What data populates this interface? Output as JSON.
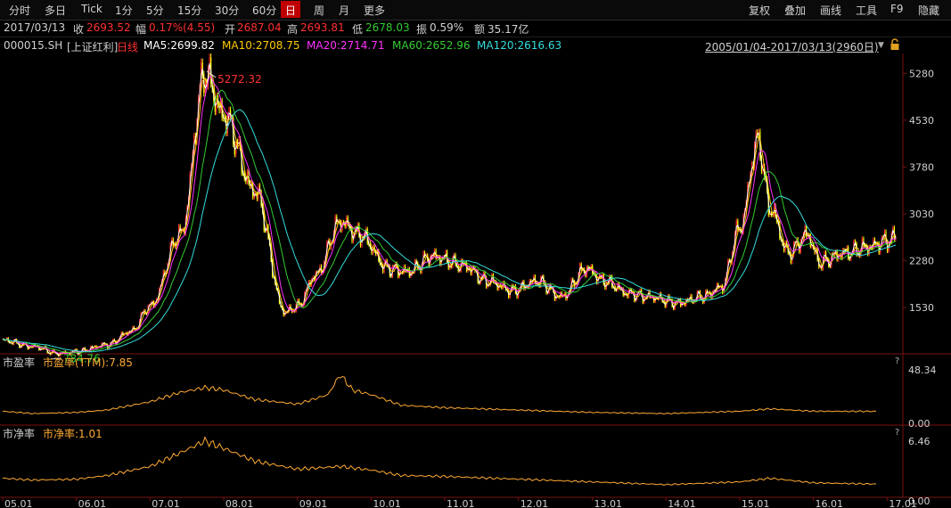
{
  "toolbar": {
    "left": [
      "分时",
      "多日",
      "Tick",
      "1分",
      "5分",
      "15分",
      "30分",
      "60分",
      "日",
      "周",
      "月",
      "更多"
    ],
    "right": [
      "复权",
      "叠加",
      "画线",
      "工具",
      "F9",
      "隐藏"
    ],
    "active": "日"
  },
  "quote": {
    "date": "2017/03/13",
    "close_label": "收",
    "close": "2693.52",
    "change_label": "幅",
    "change": "0.17%(4.55)",
    "open_label": "开",
    "open": "2687.04",
    "high_label": "高",
    "high": "2693.81",
    "low_label": "低",
    "low": "2678.03",
    "amp_label": "振",
    "amplitude": "0.59%",
    "amount_label": "额",
    "amount": "35.17亿"
  },
  "indicator": {
    "code": "000015.SH",
    "name": "[上证红利]",
    "period": "日线",
    "ma": [
      {
        "text": "MA5:2699.82",
        "color": "#ffffff"
      },
      {
        "text": "MA10:2708.75",
        "color": "#ffcc00"
      },
      {
        "text": "MA20:2714.71",
        "color": "#ff33ff"
      },
      {
        "text": "MA60:2652.96",
        "color": "#33cc33"
      },
      {
        "text": "MA120:2616.63",
        "color": "#33dddd"
      }
    ],
    "range": "2005/01/04-2017/03/13(2960日)"
  },
  "colors": {
    "up": "#ff3030",
    "down": "#ffff00",
    "ma5": "#ffffff",
    "ma10": "#ffcc00",
    "ma20": "#ff33ff",
    "ma60": "#33cc33",
    "ma120": "#33dddd",
    "sub": "#ffaa33"
  },
  "pe_panel": {
    "name": "市盈率",
    "indicator": "市盈率(TTM):7.85",
    "help": "?",
    "axis_top": "48.34",
    "axis_bottom": "0.00"
  },
  "pb_panel": {
    "name": "市净率",
    "indicator": "市净率:1.01",
    "help": "?",
    "axis_top": "6.46",
    "axis_bottom": "0.00"
  },
  "chart_data": [
    {
      "type": "line",
      "title": "000015.SH [上证红利] 日线",
      "x": [
        "2005-01",
        "2005-06",
        "2005-10",
        "2006-01",
        "2006-06",
        "2006-10",
        "2007-01",
        "2007-06",
        "2007-10",
        "2008-01",
        "2008-06",
        "2008-11",
        "2009-01",
        "2009-04",
        "2009-08",
        "2009-11",
        "2010-04",
        "2010-07",
        "2010-11",
        "2011-04",
        "2011-08",
        "2011-12",
        "2012-04",
        "2012-08",
        "2012-12",
        "2013-03",
        "2013-07",
        "2013-10",
        "2014-03",
        "2014-07",
        "2014-10",
        "2015-01",
        "2015-04",
        "2015-06",
        "2015-09",
        "2015-12",
        "2016-02",
        "2016-06",
        "2016-10",
        "2017-01",
        "2017-03"
      ],
      "series": [
        {
          "name": "",
          "values": [
            1000,
            900,
            790,
            820,
            930,
            1150,
            1550,
            2700,
            5272,
            4600,
            3400,
            1450,
            1550,
            2050,
            2900,
            2700,
            2150,
            2100,
            2350,
            2200,
            1950,
            1800,
            1950,
            1700,
            2150,
            1950,
            1750,
            1700,
            1600,
            1700,
            1850,
            2800,
            4200,
            3100,
            2400,
            2700,
            2250,
            2400,
            2500,
            2600,
            2693
          ]
        }
      ],
      "yticks": [
        "5280",
        "4530",
        "3780",
        "3030",
        "2280",
        "1530"
      ],
      "ylim": [
        800,
        5600
      ],
      "annotations": [
        {
          "text": "5272.32",
          "color": "#ff3030"
        },
        {
          "text": "784.76",
          "color": "#33cc33"
        }
      ],
      "xtick_labels": [
        "05.01",
        "06.01",
        "07.01",
        "08.01",
        "09.01",
        "10.01",
        "11.01",
        "12.01",
        "13.01",
        "14.01",
        "15.01",
        "16.01",
        "17.01"
      ]
    },
    {
      "type": "line",
      "title": "市盈率",
      "x": [
        "2005-01",
        "2005-06",
        "2006-01",
        "2006-06",
        "2007-01",
        "2007-06",
        "2007-10",
        "2008-01",
        "2008-06",
        "2009-01",
        "2009-06",
        "2009-08",
        "2009-10",
        "2010-01",
        "2010-06",
        "2011-01",
        "2012-01",
        "2013-01",
        "2014-01",
        "2015-01",
        "2015-06",
        "2016-01",
        "2017-03"
      ],
      "series": [
        {
          "name": "市盈率(TTM)",
          "values": [
            8,
            6,
            7,
            9,
            16,
            24,
            28,
            26,
            18,
            14,
            22,
            39,
            26,
            22,
            13,
            11,
            9,
            7,
            6,
            8,
            10,
            8,
            7.85
          ]
        }
      ],
      "ylim": [
        0,
        48.34
      ]
    },
    {
      "type": "line",
      "title": "市净率",
      "x": [
        "2005-01",
        "2005-06",
        "2006-01",
        "2006-06",
        "2007-01",
        "2007-06",
        "2007-10",
        "2008-01",
        "2008-06",
        "2009-01",
        "2009-08",
        "2010-01",
        "2010-06",
        "2011-01",
        "2012-01",
        "2013-01",
        "2014-01",
        "2015-01",
        "2015-06",
        "2016-01",
        "2017-03"
      ],
      "series": [
        {
          "name": "市净率",
          "values": [
            1.7,
            1.5,
            1.6,
            2.0,
            3.0,
            4.5,
            5.8,
            5.0,
            3.6,
            2.7,
            3.0,
            2.6,
            2.0,
            1.9,
            1.6,
            1.3,
            1.0,
            1.3,
            1.7,
            1.2,
            1.01
          ]
        }
      ],
      "ylim": [
        0,
        6.46
      ]
    }
  ]
}
